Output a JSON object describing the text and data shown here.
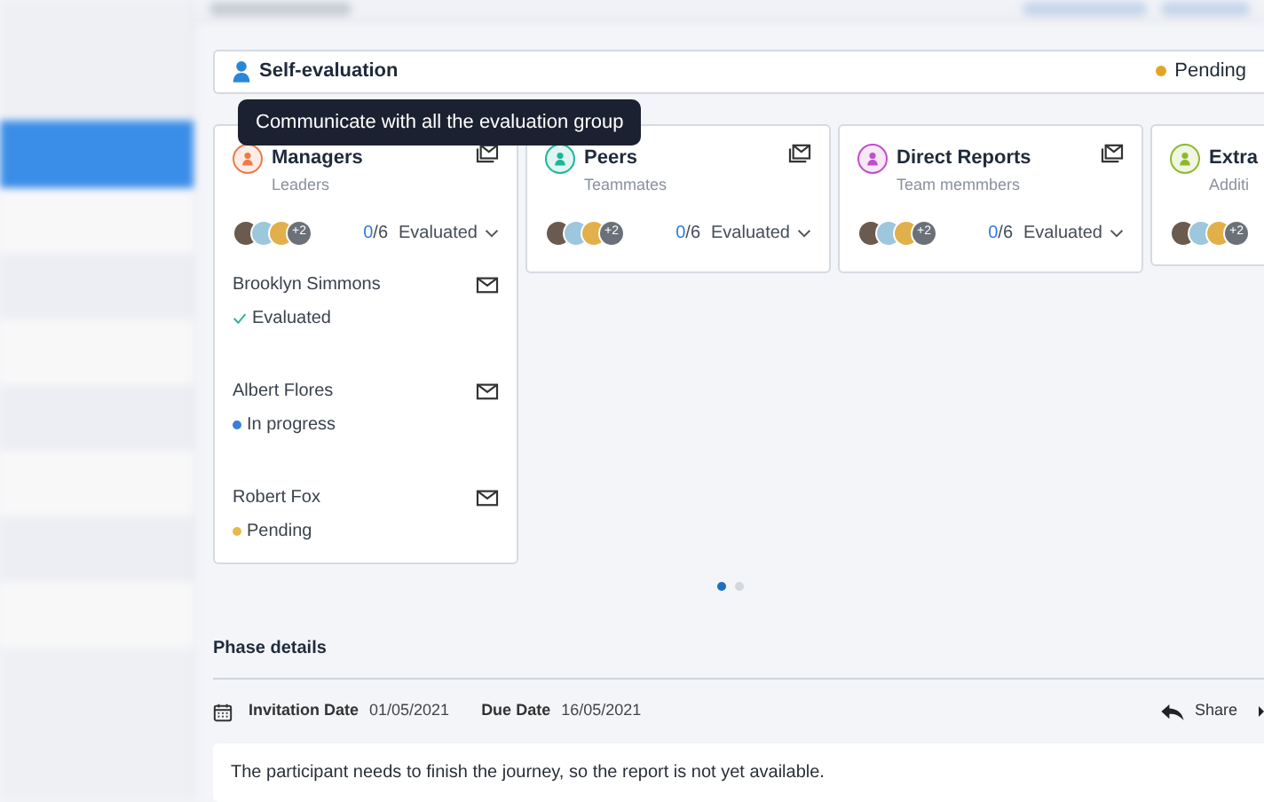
{
  "self_evaluation": {
    "label": "Self-evaluation",
    "status": "Pending"
  },
  "tooltip": {
    "text": "Communicate with all the evaluation group"
  },
  "groups": [
    {
      "name": "Managers",
      "subtitle": "Leaders",
      "color": "#ee7a45",
      "extra_avatars": "+2",
      "done": "0",
      "total": "/6",
      "filter": "Evaluated",
      "members": [
        {
          "name": "Brooklyn Simmons",
          "kind": "evaluated",
          "status": "Evaluated"
        },
        {
          "name": "Albert Flores",
          "kind": "dot",
          "status": "In progress",
          "color": "#3b7dd8"
        },
        {
          "name": "Robert Fox",
          "kind": "dot",
          "status": "Pending",
          "color": "#e8b84a"
        }
      ]
    },
    {
      "name": "Peers",
      "subtitle": "Teammates",
      "color": "#1fb59a",
      "extra_avatars": "+2",
      "done": "0",
      "total": "/6",
      "filter": "Evaluated"
    },
    {
      "name": "Direct Reports",
      "subtitle": "Team memmbers",
      "color": "#c04fc9",
      "extra_avatars": "+2",
      "done": "0",
      "total": "/6",
      "filter": "Evaluated"
    },
    {
      "name": "Extra",
      "subtitle": "Additi",
      "color": "#8db92e",
      "extra_avatars": "+2"
    }
  ],
  "pager": [
    {
      "selected": true
    },
    {
      "selected": false
    }
  ],
  "phase": {
    "title": "Phase details",
    "invitation_label": "Invitation Date",
    "invitation_date": "01/05/2021",
    "due_label": "Due Date",
    "due_date": "16/05/2021",
    "share": "Share",
    "message": "The participant needs to finish the journey, so the report is not yet available."
  }
}
